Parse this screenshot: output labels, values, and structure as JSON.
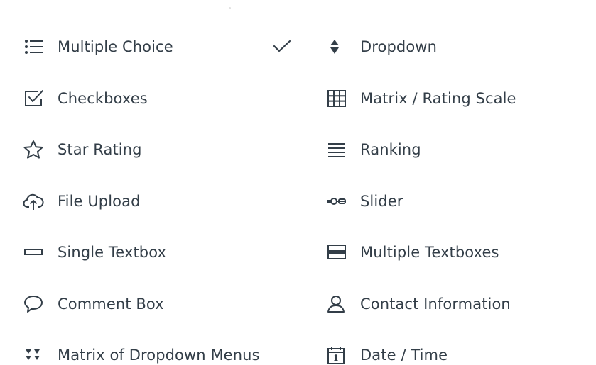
{
  "question_types": {
    "left": [
      {
        "label": "Multiple Choice",
        "icon": "list-bullets-icon",
        "selected": true
      },
      {
        "label": "Checkboxes",
        "icon": "checkbox-icon",
        "selected": false
      },
      {
        "label": "Star Rating",
        "icon": "star-icon",
        "selected": false
      },
      {
        "label": "File Upload",
        "icon": "cloud-upload-icon",
        "selected": false
      },
      {
        "label": "Single Textbox",
        "icon": "single-textbox-icon",
        "selected": false
      },
      {
        "label": "Comment Box",
        "icon": "speech-bubble-icon",
        "selected": false
      },
      {
        "label": "Matrix of Dropdown Menus",
        "icon": "matrix-dropdown-icon",
        "selected": false
      }
    ],
    "right": [
      {
        "label": "Dropdown",
        "icon": "dropdown-arrows-icon",
        "selected": false
      },
      {
        "label": "Matrix / Rating Scale",
        "icon": "grid-icon",
        "selected": false
      },
      {
        "label": "Ranking",
        "icon": "ranking-lines-icon",
        "selected": false
      },
      {
        "label": "Slider",
        "icon": "slider-icon",
        "selected": false
      },
      {
        "label": "Multiple Textboxes",
        "icon": "multiple-textboxes-icon",
        "selected": false
      },
      {
        "label": "Contact Information",
        "icon": "person-icon",
        "selected": false
      },
      {
        "label": "Date / Time",
        "icon": "calendar-icon",
        "selected": false
      }
    ]
  },
  "colors": {
    "text": "#333e48",
    "icon": "#333e48",
    "divider": "#ececec"
  }
}
